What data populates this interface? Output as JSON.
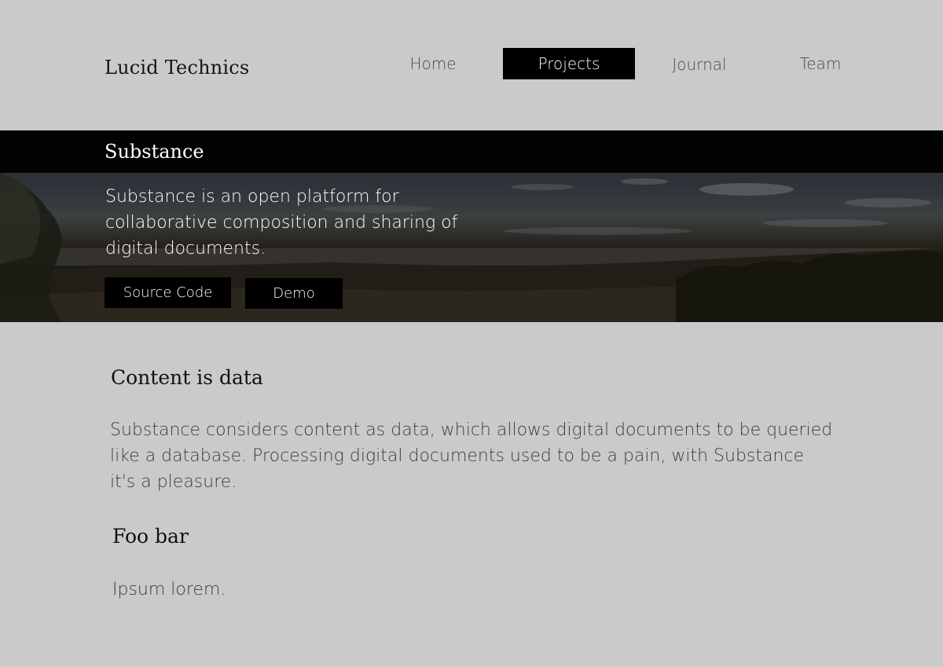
{
  "brand": {
    "name": "Lucid Technics"
  },
  "nav": {
    "items": [
      {
        "label": "Home"
      },
      {
        "label": "Projects"
      },
      {
        "label": "Journal"
      },
      {
        "label": "Team"
      }
    ],
    "active": "Projects"
  },
  "hero": {
    "title": "Substance",
    "description": "Substance is an open platform for collaborative composition and sharing of digital documents.",
    "buttons": [
      {
        "label": "Source Code"
      },
      {
        "label": "Demo"
      }
    ]
  },
  "sections": [
    {
      "title": "Content is data",
      "body": "Substance considers content as data, which allows digital documents to be queried like a database. Processing digital documents used to be a pain, with Substance it's a pleasure."
    },
    {
      "title": "Foo bar",
      "body": "Ipsum lorem."
    }
  ],
  "colors": {
    "page_background": "#cacaca",
    "active_nav_background": "#000000",
    "hero_overlay": "#000000"
  }
}
